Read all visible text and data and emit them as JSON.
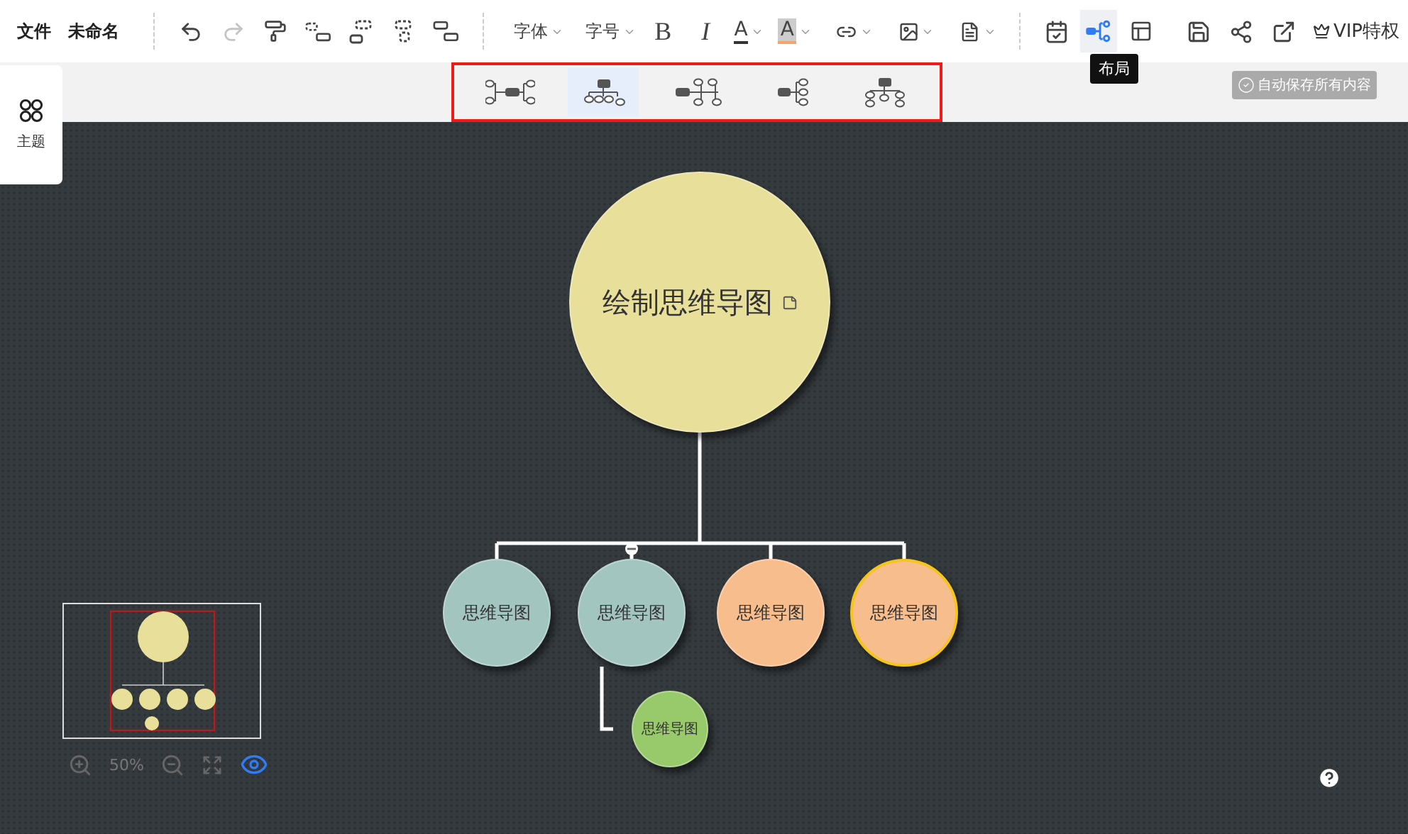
{
  "menu": [
    {
      "label": "文件"
    },
    {
      "label": "未命名"
    }
  ],
  "toolbar": {
    "redo_disabled": true,
    "font": "字体",
    "size": "字号",
    "bold": "B",
    "italic": "I",
    "font_color": "A",
    "highlight": "A",
    "layout_selected": true,
    "vip": "VIP特权"
  },
  "tooltip": "布局",
  "side_panel": {
    "label": "主题"
  },
  "layouts": [
    {
      "selected": false
    },
    {
      "selected": true
    },
    {
      "selected": false
    },
    {
      "selected": false
    },
    {
      "selected": false
    }
  ],
  "autosave": "自动保存所有内容",
  "mindmap": {
    "root": {
      "text": "绘制思维导图",
      "color": "#e8df9a"
    },
    "children": [
      {
        "text": "思维导图",
        "color": "#a3c5c0",
        "selected": false,
        "collapsible": false
      },
      {
        "text": "思维导图",
        "color": "#a3c5c0",
        "selected": false,
        "collapsible": true,
        "children": [
          {
            "text": "思维导图",
            "color": "#98c96b"
          }
        ]
      },
      {
        "text": "思维导图",
        "color": "#f7bd8d",
        "selected": false,
        "collapsible": false
      },
      {
        "text": "思维导图",
        "color": "#f7bd8d",
        "selected": true,
        "collapsible": false
      }
    ]
  },
  "zoom": {
    "level_text": "50%",
    "preview_on": true
  }
}
